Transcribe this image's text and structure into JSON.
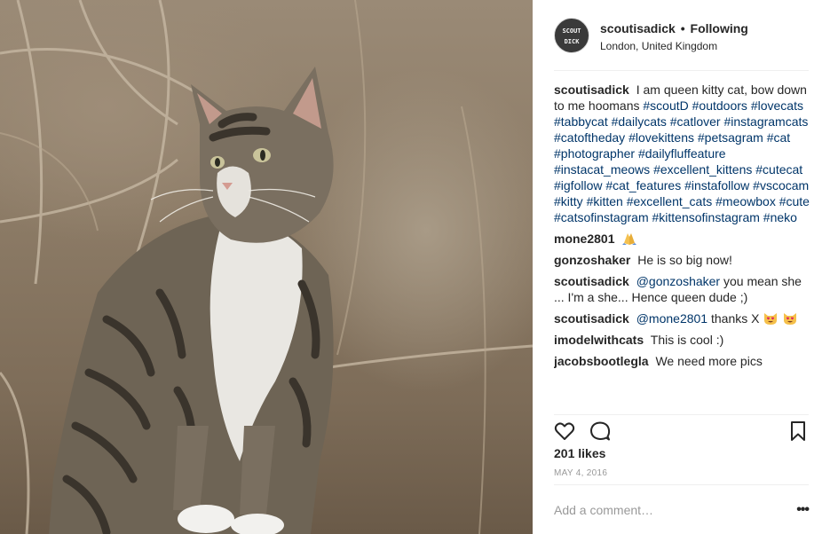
{
  "header": {
    "username": "scoutisadick",
    "separator": "•",
    "follow_status": "Following",
    "location": "London, United Kingdom",
    "avatar_text": "SCOUT",
    "avatar_text2": "DICK"
  },
  "caption": {
    "username": "scoutisadick",
    "text": "I am queen kitty cat, bow down to me hoomans",
    "hashtags": [
      "#scoutD",
      "#outdoors",
      "#lovecats",
      "#tabbycat",
      "#dailycats",
      "#catlover",
      "#instagramcats",
      "#catoftheday",
      "#lovekittens",
      "#petsagram",
      "#cat",
      "#photographer",
      "#dailyfluffeature",
      "#instacat_meows",
      "#excellent_kittens",
      "#cutecat",
      "#igfollow",
      "#cat_features",
      "#instafollow",
      "#vscocam",
      "#kitty",
      "#kitten",
      "#excellent_cats",
      "#meowbox",
      "#cute",
      "#catsofinstagram",
      "#kittensofinstagram",
      "#neko"
    ]
  },
  "comments": [
    {
      "user": "mone2801",
      "mention": "",
      "text": "",
      "emoji": "folded-hands"
    },
    {
      "user": "gonzoshaker",
      "mention": "",
      "text": "He is so big now!",
      "emoji": ""
    },
    {
      "user": "scoutisadick",
      "mention": "@gonzoshaker",
      "text": "you mean she ... I'm a she... Hence queen dude ;)",
      "emoji": ""
    },
    {
      "user": "scoutisadick",
      "mention": "@mone2801",
      "text": "thanks X",
      "emoji": "heart-eyes-cat"
    },
    {
      "user": "imodelwithcats",
      "mention": "",
      "text": "This is cool :)",
      "emoji": ""
    },
    {
      "user": "jacobsbootlegla",
      "mention": "",
      "text": "We need more pics",
      "emoji": ""
    }
  ],
  "actions": {
    "like_icon": "heart-icon",
    "comment_icon": "comment-icon",
    "save_icon": "bookmark-icon"
  },
  "likes": "201 likes",
  "date": "MAY 4, 2016",
  "add_comment": {
    "placeholder": "Add a comment…",
    "more_label": "•••"
  },
  "colors": {
    "text": "#262626",
    "link": "#003569",
    "muted": "#999999",
    "divider": "#efefef"
  }
}
